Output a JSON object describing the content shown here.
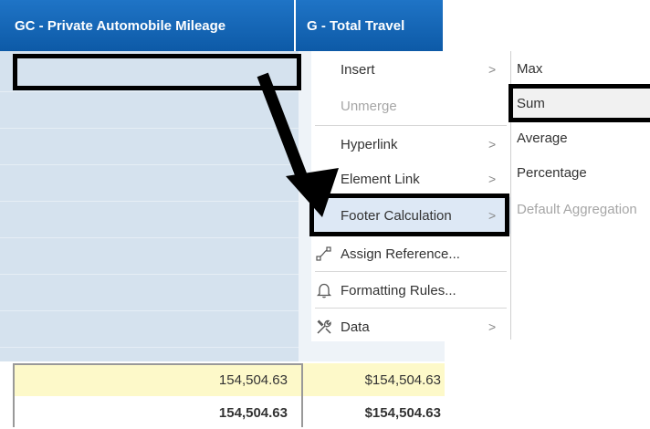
{
  "columns": {
    "gc_header": "GC - Private Automobile Mileage",
    "g_header": "G - Total Travel"
  },
  "context_menu": {
    "items": [
      {
        "label": "Insert",
        "submenu": true,
        "disabled": false,
        "icon": ""
      },
      {
        "label": "Unmerge",
        "submenu": false,
        "disabled": true,
        "icon": ""
      },
      {
        "label": "Hyperlink",
        "submenu": true,
        "disabled": false,
        "icon": ""
      },
      {
        "label": "Element Link",
        "submenu": true,
        "disabled": false,
        "icon": ""
      },
      {
        "label": "Footer Calculation",
        "submenu": true,
        "disabled": false,
        "icon": "",
        "active": true
      },
      {
        "label": "Assign Reference...",
        "submenu": false,
        "disabled": false,
        "icon": "assign-reference-icon"
      },
      {
        "label": "Formatting Rules...",
        "submenu": false,
        "disabled": false,
        "icon": "bell-icon"
      },
      {
        "label": "Data",
        "submenu": true,
        "disabled": false,
        "icon": "tools-icon"
      }
    ],
    "chevron": ">"
  },
  "footer_submenu": {
    "items": [
      {
        "label": "Max",
        "disabled": false
      },
      {
        "label": "Sum",
        "disabled": false,
        "selected": true
      },
      {
        "label": "Average",
        "disabled": false
      },
      {
        "label": "Percentage",
        "disabled": false
      },
      {
        "label": "Default Aggregation",
        "disabled": true
      }
    ]
  },
  "footer_rows": [
    {
      "gc_value": "154,504.63",
      "g_value": "$154,504.63"
    },
    {
      "gc_value": "154,504.63",
      "g_value": "$154,504.63"
    }
  ],
  "colors": {
    "header_bg": "#1565b8",
    "selected_column": "#d5e2ee",
    "footer_highlight": "#fdf9c9",
    "annotation": "#000000"
  }
}
